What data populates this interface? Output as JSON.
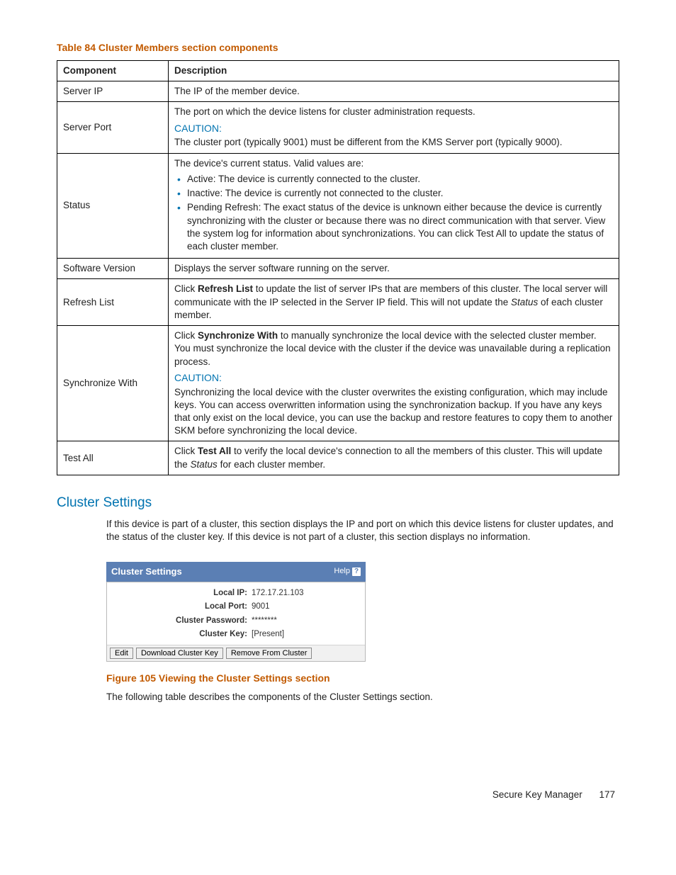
{
  "table_title": "Table 84 Cluster Members section components",
  "headers": {
    "col1": "Component",
    "col2": "Description"
  },
  "rows": {
    "server_ip": {
      "name": "Server IP",
      "desc": "The IP of the member device."
    },
    "server_port": {
      "name": "Server Port",
      "line1": "The port on which the device listens for cluster administration requests.",
      "caution": "CAUTION:",
      "line2": "The cluster port (typically 9001) must be different from the KMS Server port (typically 9000)."
    },
    "status": {
      "name": "Status",
      "intro": "The device's current status.  Valid values are:",
      "items": [
        "Active: The device is currently connected to the cluster.",
        "Inactive: The device is currently not connected to the cluster.",
        "Pending Refresh: The exact status of the device is unknown either because the device is currently synchronizing with the cluster or because there was no direct communication with that server.  View the system log for information about synchronizations.  You can click Test All to update the status of each cluster member."
      ]
    },
    "software_version": {
      "name": "Software Version",
      "desc": "Displays the server software running on the server."
    },
    "refresh_list": {
      "name": "Refresh List",
      "pre": "Click ",
      "bold": "Refresh List",
      "mid": " to update the list of server IPs that are members of this cluster. The local server will communicate with the IP selected in the Server IP field. This will not update the ",
      "italic": "Status",
      "post": " of each cluster member."
    },
    "synchronize_with": {
      "name": "Synchronize With",
      "p1_pre": "Click ",
      "p1_bold": "Synchronize With",
      "p1_post": " to manually synchronize the local device with the selected cluster member. You must synchronize the local device with the cluster if the device was unavailable during a replication process.",
      "caution": "CAUTION:",
      "p2": "Synchronizing the local device with the cluster overwrites the existing configuration, which may include keys. You can access overwritten information using the synchronization backup. If you have any keys that only exist on the local device, you can use the backup and restore features to copy them to another SKM before synchronizing the local device."
    },
    "test_all": {
      "name": "Test All",
      "pre": "Click ",
      "bold": "Test All",
      "mid": " to verify the local device's connection to all the members of this cluster. This will update the ",
      "italic": "Status",
      "post": " for each cluster member."
    }
  },
  "section_heading": "Cluster Settings",
  "section_paragraph": "If this device is part of a cluster, this section displays the IP and port on which this device listens for cluster updates, and the status of the cluster key. If this device is not part of a cluster, this section displays no information.",
  "panel": {
    "title": "Cluster Settings",
    "help": "Help",
    "rows": {
      "local_ip": {
        "label": "Local IP:",
        "value": "172.17.21.103"
      },
      "local_port": {
        "label": "Local Port:",
        "value": "9001"
      },
      "password": {
        "label": "Cluster Password:",
        "value": "********"
      },
      "key": {
        "label": "Cluster Key:",
        "value": "[Present]"
      }
    },
    "buttons": {
      "edit": "Edit",
      "download": "Download Cluster Key",
      "remove": "Remove From Cluster"
    }
  },
  "figure_label": "Figure 105 Viewing the Cluster Settings section",
  "figure_caption": "The following table describes the components of the Cluster Settings section.",
  "footer": {
    "doc": "Secure Key Manager",
    "page": "177"
  }
}
